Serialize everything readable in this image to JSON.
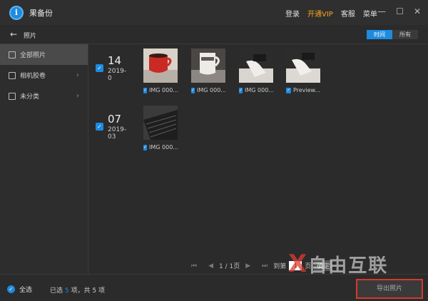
{
  "app": {
    "title": "果备份"
  },
  "top_links": [
    "登录",
    "开通VIP",
    "客服",
    "菜单"
  ],
  "window_controls": [
    "minimize-icon",
    "maximize-icon",
    "close-icon"
  ],
  "subbar": {
    "breadcrumb": "照片",
    "view_modes": [
      "时间",
      "所有"
    ],
    "active_view": "时间"
  },
  "sidebar": {
    "items": [
      {
        "label": "全部照片",
        "active": true,
        "icon": "photos-icon"
      },
      {
        "label": "相机胶卷",
        "active": false,
        "icon": "image-icon"
      },
      {
        "label": "未分类",
        "active": false,
        "icon": "image-icon"
      }
    ]
  },
  "groups": [
    {
      "day": "14",
      "date": "2019-0",
      "items": [
        {
          "caption": "IMG 000...",
          "scene": "red-cup"
        },
        {
          "caption": "IMG 000...",
          "scene": "mug"
        },
        {
          "caption": "IMG 000...",
          "scene": "hand-device"
        },
        {
          "caption": "Preview...",
          "scene": "hand-device"
        }
      ]
    },
    {
      "day": "07",
      "date": "2019-03",
      "items": [
        {
          "caption": "IMG 000...",
          "scene": "keyboard"
        }
      ]
    }
  ],
  "pager": {
    "page_info": "1 / 1页",
    "goto_label": "到第",
    "page_value": "1",
    "page_unit": "页",
    "go_label": "确定"
  },
  "footer": {
    "select_all": "全选",
    "status_prefix": "已选 ",
    "selected": "5",
    "status_mid": " 项，共 ",
    "total": "5",
    "status_suffix": " 项",
    "export_label": "导出照片"
  },
  "watermark": {
    "mark": "X",
    "text": "自由互联"
  },
  "colors": {
    "accent": "#1d8be0",
    "vip": "#f5a623",
    "highlight_border": "#d23b2a"
  }
}
